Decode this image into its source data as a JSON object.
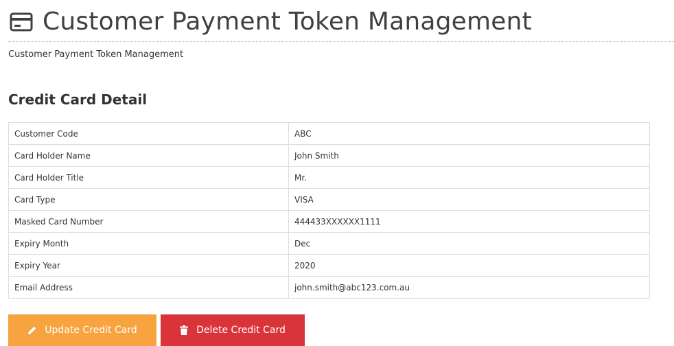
{
  "header": {
    "icon": "credit-card-icon",
    "title": "Customer Payment Token Management"
  },
  "subtitle": "Customer Payment Token Management",
  "section": {
    "title": "Credit Card Detail"
  },
  "details": {
    "rows": [
      {
        "label": "Customer Code",
        "value": "ABC"
      },
      {
        "label": "Card Holder Name",
        "value": "John Smith"
      },
      {
        "label": "Card Holder Title",
        "value": "Mr."
      },
      {
        "label": "Card Type",
        "value": "VISA"
      },
      {
        "label": "Masked Card Number",
        "value": "444433XXXXXX1111"
      },
      {
        "label": "Expiry Month",
        "value": "Dec"
      },
      {
        "label": "Expiry Year",
        "value": "2020"
      },
      {
        "label": "Email Address",
        "value": "john.smith@abc123.com.au"
      }
    ]
  },
  "actions": {
    "update_label": "Update Credit Card",
    "update_icon": "pencil-icon",
    "delete_label": "Delete Credit Card",
    "delete_icon": "trash-icon"
  },
  "colors": {
    "update_button": "#f6a340",
    "delete_button": "#d9343a",
    "heading_text": "#404040"
  }
}
